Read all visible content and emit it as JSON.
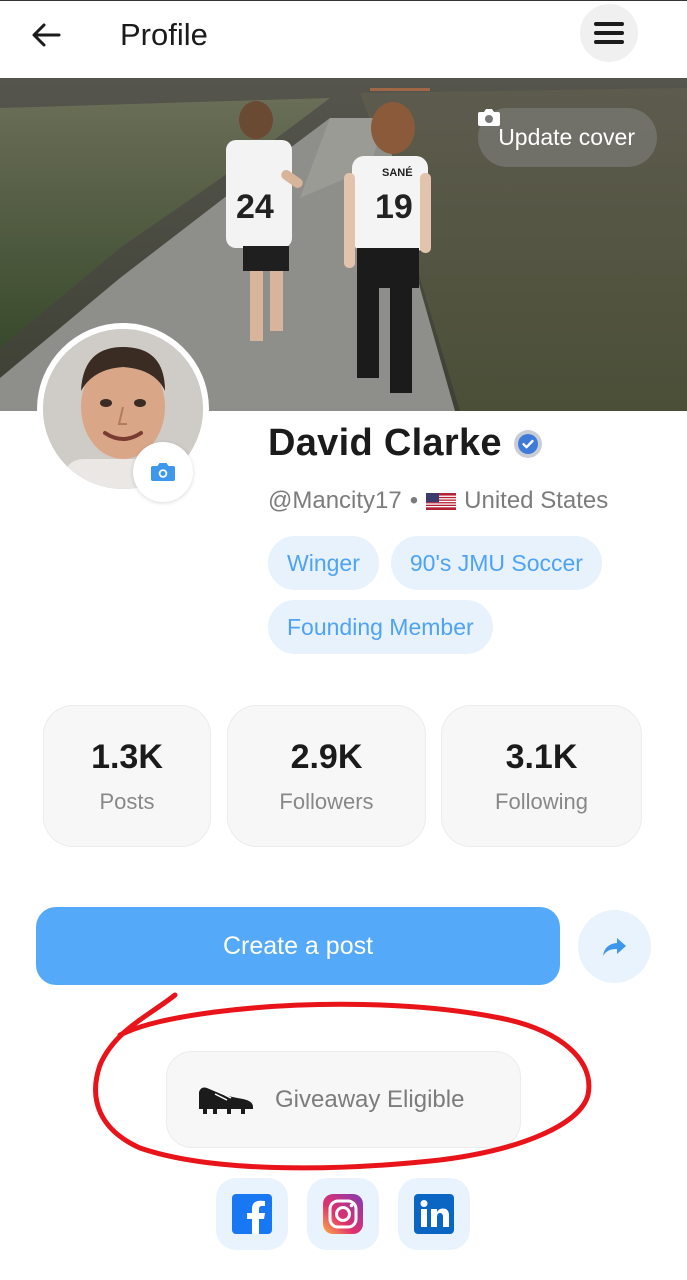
{
  "header": {
    "title": "Profile",
    "back_icon": "arrow-left-icon",
    "menu_icon": "hamburger-menu-icon"
  },
  "cover": {
    "update_label": "Update cover",
    "jersey_left_number": "24",
    "jersey_right_number": "19",
    "jersey_right_name": "SANÉ"
  },
  "profile": {
    "name": "David Clarke",
    "handle": "@Mancity17",
    "separator": "•",
    "country": "United States",
    "verified": true
  },
  "tags": [
    "Winger",
    "90's JMU Soccer",
    "Founding Member"
  ],
  "stats": [
    {
      "value": "1.3K",
      "label": "Posts"
    },
    {
      "value": "2.9K",
      "label": "Followers"
    },
    {
      "value": "3.1K",
      "label": "Following"
    }
  ],
  "actions": {
    "create_post_label": "Create a post",
    "share_icon": "share-arrow-icon"
  },
  "giveaway": {
    "label": "Giveaway Eligible",
    "icon": "soccer-cleat-icon"
  },
  "social": [
    {
      "name": "facebook",
      "icon": "facebook-icon"
    },
    {
      "name": "instagram",
      "icon": "instagram-icon"
    },
    {
      "name": "linkedin",
      "icon": "linkedin-icon"
    }
  ],
  "colors": {
    "accent": "#54aaf9",
    "tag_bg": "#e7f2fd",
    "tag_text": "#4ea3f4",
    "annotation": "#e8141a"
  }
}
